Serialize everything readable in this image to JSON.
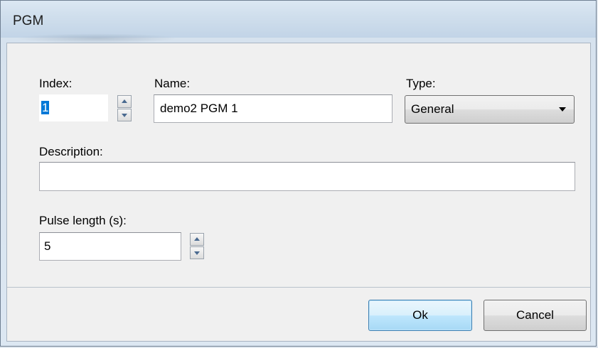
{
  "window": {
    "title": "PGM"
  },
  "index": {
    "label": "Index:",
    "value": "1"
  },
  "name": {
    "label": "Name:",
    "value": "demo2 PGM 1"
  },
  "type": {
    "label": "Type:",
    "value": "General"
  },
  "description": {
    "label": "Description:",
    "value": ""
  },
  "pulse": {
    "label": "Pulse length (s):",
    "value": "5"
  },
  "buttons": {
    "ok": "Ok",
    "cancel": "Cancel"
  }
}
